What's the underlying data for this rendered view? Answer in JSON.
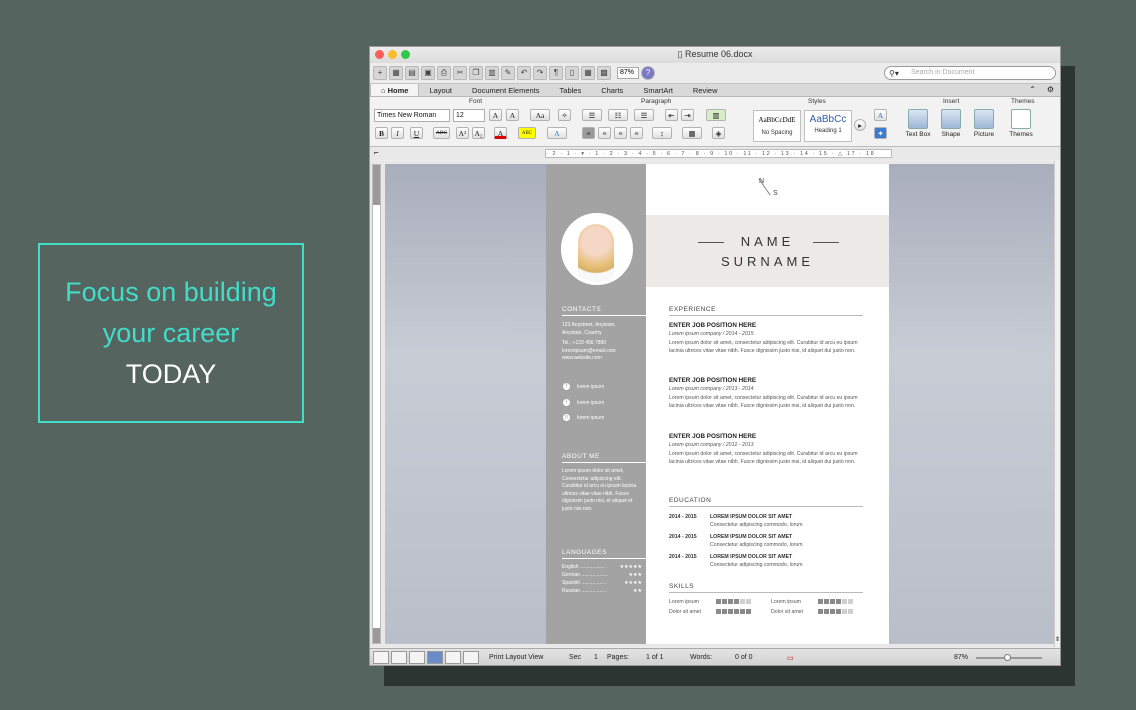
{
  "promo": {
    "line1": "Focus on building",
    "line2": "your career",
    "line3": "TODAY"
  },
  "window": {
    "title": "Resume 06.docx"
  },
  "toolbar": {
    "zoom": "87%",
    "search_placeholder": "Search in Document"
  },
  "tabs": [
    "Home",
    "Layout",
    "Document Elements",
    "Tables",
    "Charts",
    "SmartArt",
    "Review"
  ],
  "ribbon": {
    "groups": {
      "font": "Font",
      "paragraph": "Paragraph",
      "styles": "Styles",
      "insert": "Insert",
      "themes": "Themes"
    },
    "font_name": "Times New Roman",
    "font_size": "12",
    "style1_preview": "AaBbCcDdE",
    "style1_name": "No Spacing",
    "style2_preview": "AaBbCc",
    "style2_name": "Heading 1",
    "insert_textbox": "Text Box",
    "insert_shape": "Shape",
    "insert_picture": "Picture",
    "themes_label": "Themes",
    "ruler": "· 2 · 1 · ▾ · 1 · 2 · 3 · 4 · 5 · 6 · 7 · 8 · 9 · 10 · 11 · 12 · 13 · 14 · 15 · △ 17 · 18"
  },
  "resume": {
    "monogram_n": "N",
    "monogram_s": "S",
    "name": "NAME",
    "surname": "SURNAME",
    "contacts_heading": "CONTACTS",
    "address1": "123 Anystreet, Anytown,",
    "address2": "Anystate, Country",
    "tel": "Tel.: +123 456 7890",
    "email": "loremipsum@email.com",
    "website": "www.website.com",
    "social": [
      "lorem ipsum",
      "lorem ipsum",
      "lorem ipsum"
    ],
    "about_heading": "ABOUT ME",
    "about_text": "Lorem ipsum dolor sit amet, Consectetur adipiscing elit. Curabitur id arcu eu ipsum lacinia ultrices vitae vitae nibh. Fusce dignissim justo nisi, et aliquet et justo nisi non.",
    "languages_heading": "LANGUAGES",
    "languages": [
      {
        "name": "English ..................",
        "level": "★★★★★"
      },
      {
        "name": "German ...................",
        "level": "★★★"
      },
      {
        "name": "Spanish ..................",
        "level": "★★★★"
      },
      {
        "name": "Russian ..................",
        "level": "★★"
      }
    ],
    "experience_heading": "EXPERIENCE",
    "jobs": [
      {
        "title": "ENTER JOB POSITION HERE",
        "company": "Lorem ipsum company / 2014 - 2015",
        "desc": "Lorem ipsum dolor sit amet, consectetur adipiscing elit. Curabitur id arcu eu ipsum lacinia ultrices vitae vitae nibh. Fusce dignissim justo nisi, id aliquet dui justo non."
      },
      {
        "title": "ENTER JOB POSITION HERE",
        "company": "Lorem ipsum company / 2013 - 2014",
        "desc": "Lorem ipsum dolor sit amet, consectetur adipiscing elit. Curabitur id arcu eu ipsum lacinia ultrices vitae vitae nibh. Fusce dignissim justo nisi, id aliquet dui justo non."
      },
      {
        "title": "ENTER JOB POSITION HERE",
        "company": "Lorem ipsum company / 2012 - 2013",
        "desc": "Lorem ipsum dolor sit amet, consectetur adipiscing elit. Curabitur id arcu eu ipsum lacinia ultrices vitae vitae nibh. Fusce dignissim justo nisi, id aliquet dui justo non."
      }
    ],
    "education_heading": "EDUCATION",
    "education": [
      {
        "years": "2014 - 2015",
        "degree": "LOREM IPSUM DOLOR SIT AMET",
        "school": "Consectetur adipiscing commodo, lorum"
      },
      {
        "years": "2014 - 2015",
        "degree": "LOREM IPSUM DOLOR SIT AMET",
        "school": "Consectetur adipiscing commodo, lorum"
      },
      {
        "years": "2014 - 2015",
        "degree": "LOREM IPSUM DOLOR SIT AMET",
        "school": "Consectetur adipiscing commodo, lorum"
      }
    ],
    "skills_heading": "SKILLS",
    "skills": [
      {
        "name": "Lorem ipsum",
        "level": 4,
        "max": 6
      },
      {
        "name": "Lorem ipsum",
        "level": 4,
        "max": 6
      },
      {
        "name": "Dolor sit amet",
        "level": 6,
        "max": 6
      },
      {
        "name": "Dolor sit amet",
        "level": 4,
        "max": 6
      }
    ]
  },
  "status": {
    "view": "Print Layout View",
    "sec_label": "Sec",
    "sec": "1",
    "pages_label": "Pages:",
    "pages": "1 of 1",
    "words_label": "Words:",
    "words": "0 of 0",
    "zoom": "87%"
  }
}
